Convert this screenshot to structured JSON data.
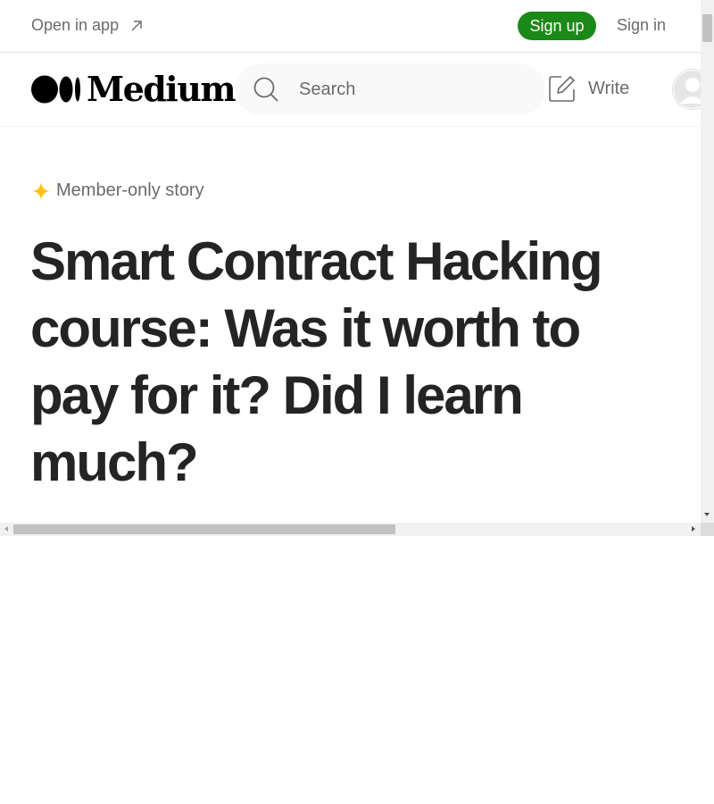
{
  "topbar": {
    "open_in_app": "Open in app",
    "sign_up": "Sign up",
    "sign_in": "Sign in"
  },
  "header": {
    "logo_text": "Medium",
    "search_placeholder": "Search",
    "write_label": "Write"
  },
  "article": {
    "member_badge": "Member-only story",
    "title": "Smart Contract Hacking course: Was it worth to pay for it? Did I learn much?"
  },
  "colors": {
    "brand_green": "#1a8917",
    "star_yellow": "#FFC017",
    "text_dark": "#242424",
    "text_muted": "#6b6b6b"
  },
  "icons": [
    "arrow-up-right-icon",
    "medium-logo-icon",
    "search-icon",
    "write-icon",
    "avatar-icon",
    "star-icon"
  ]
}
